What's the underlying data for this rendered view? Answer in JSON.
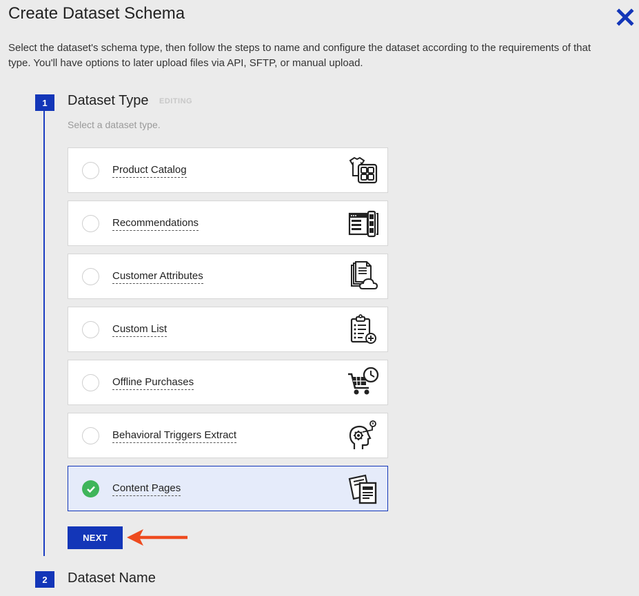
{
  "header": {
    "title": "Create Dataset Schema",
    "description": "Select the dataset's schema type, then follow the steps to name and configure the dataset according to the requirements of that type. You'll have options to later upload files via API, SFTP, or manual upload."
  },
  "steps": [
    {
      "number": "1",
      "title": "Dataset Type",
      "status": "EDITING",
      "hint": "Select a dataset type."
    },
    {
      "number": "2",
      "title": "Dataset Name"
    }
  ],
  "options": [
    {
      "label": "Product Catalog",
      "icon": "product-catalog-icon",
      "selected": false
    },
    {
      "label": "Recommendations",
      "icon": "recommendations-icon",
      "selected": false
    },
    {
      "label": "Customer Attributes",
      "icon": "customer-attributes-icon",
      "selected": false
    },
    {
      "label": "Custom List",
      "icon": "custom-list-icon",
      "selected": false
    },
    {
      "label": "Offline Purchases",
      "icon": "offline-purchases-icon",
      "selected": false
    },
    {
      "label": "Behavioral Triggers Extract",
      "icon": "behavioral-triggers-icon",
      "selected": false
    },
    {
      "label": "Content Pages",
      "icon": "content-pages-icon",
      "selected": true
    }
  ],
  "actions": {
    "next_label": "NEXT"
  },
  "colors": {
    "primary": "#1336b8",
    "selected_bg": "#e5ebfa",
    "check": "#3fb55a",
    "arrow": "#ee4b1f",
    "background": "#ebebeb"
  }
}
